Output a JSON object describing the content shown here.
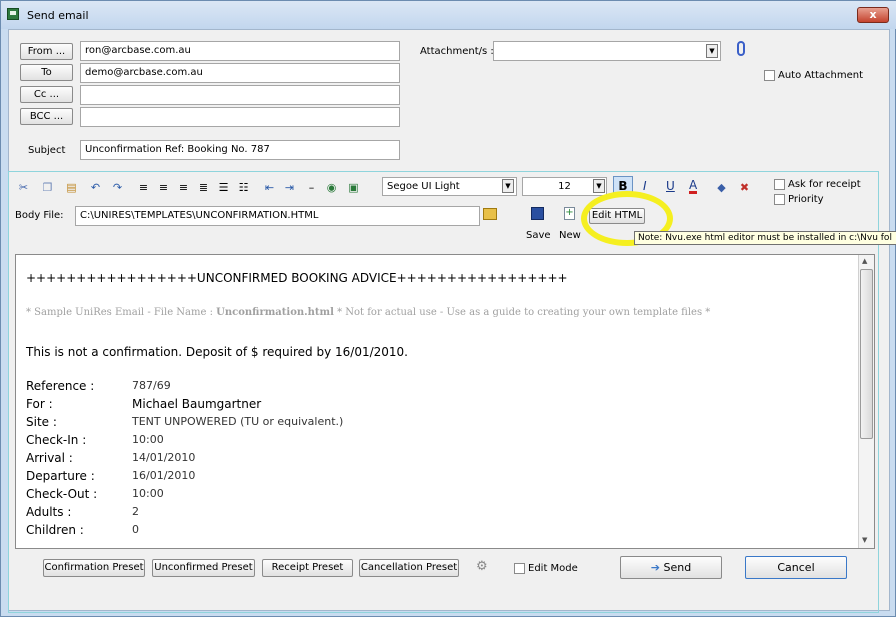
{
  "window": {
    "title": "Send email",
    "close_label": "x"
  },
  "addresses": {
    "from_label": "From ...",
    "from_value": "ron@arcbase.com.au",
    "to_label": "To",
    "to_value": "demo@arcbase.com.au",
    "cc_label": "Cc ...",
    "cc_value": "",
    "bcc_label": "BCC ...",
    "bcc_value": "",
    "subject_label": "Subject",
    "subject_value": "Unconfirmation Ref: Booking No. 787"
  },
  "attachments": {
    "label": "Attachment/s :",
    "value": "",
    "auto_label": "Auto Attachment",
    "auto_checked": false
  },
  "toolbar": {
    "font_name": "Segoe UI Light",
    "font_size": "12",
    "bold": "B",
    "italic": "I",
    "underline": "U",
    "font_color": "A",
    "ask_receipt_label": "Ask for receipt",
    "priority_label": "Priority",
    "icons": [
      "cut-icon",
      "copy-icon",
      "paste-icon",
      "undo-icon",
      "redo-icon",
      "align-left-icon",
      "align-center-icon",
      "align-right-icon",
      "justify-icon",
      "bullet-list-icon",
      "number-list-icon",
      "outdent-icon",
      "indent-icon",
      "separator-icon",
      "link-icon",
      "image-icon"
    ]
  },
  "body_file": {
    "label": "Body File:",
    "value": "C:\\UNIRES\\TEMPLATES\\UNCONFIRMATION.HTML",
    "save_label": "Save",
    "new_label": "New",
    "edit_html_label": "Edit HTML"
  },
  "tooltip": "Note: Nvu.exe  html editor must be installed in c:\\Nvu fol",
  "email_body": {
    "header": "+++++++++++++++++UNCONFIRMED BOOKING ADVICE+++++++++++++++++",
    "sample_note_prefix": "* Sample UniRes Email - File Name : ",
    "sample_note_file": "Unconfirmation.html",
    "sample_note_suffix": " * Not for actual use - Use as a guide to creating your own template files *",
    "notice": "This is not a confirmation. Deposit of $ required by 16/01/2010.",
    "rows": [
      {
        "label": "Reference :",
        "value": "787/69"
      },
      {
        "label": "For  :",
        "value": "Michael Baumgartner"
      },
      {
        "label": "Site :",
        "value": "TENT UNPOWERED (TU or equivalent.)"
      },
      {
        "label": "Check-In  :",
        "value": "10:00"
      },
      {
        "label": "Arrival   :",
        "value": "14/01/2010"
      },
      {
        "label": "Departure :",
        "value": "16/01/2010"
      },
      {
        "label": "Check-Out :",
        "value": "10:00"
      },
      {
        "label": "Adults :",
        "value": "2"
      },
      {
        "label": "Children :",
        "value": "0"
      }
    ]
  },
  "footer": {
    "confirmation_preset": "Confirmation Preset",
    "unconfirmed_preset": "Unconfirmed Preset",
    "receipt_preset": "Receipt Preset",
    "cancellation_preset": "Cancellation Preset",
    "edit_mode_label": "Edit Mode",
    "send_label": "Send",
    "cancel_label": "Cancel"
  },
  "colors": {
    "highlight": "#f5ef20",
    "tooltip_bg": "#ffffe1",
    "accent": "#3a78c8"
  }
}
